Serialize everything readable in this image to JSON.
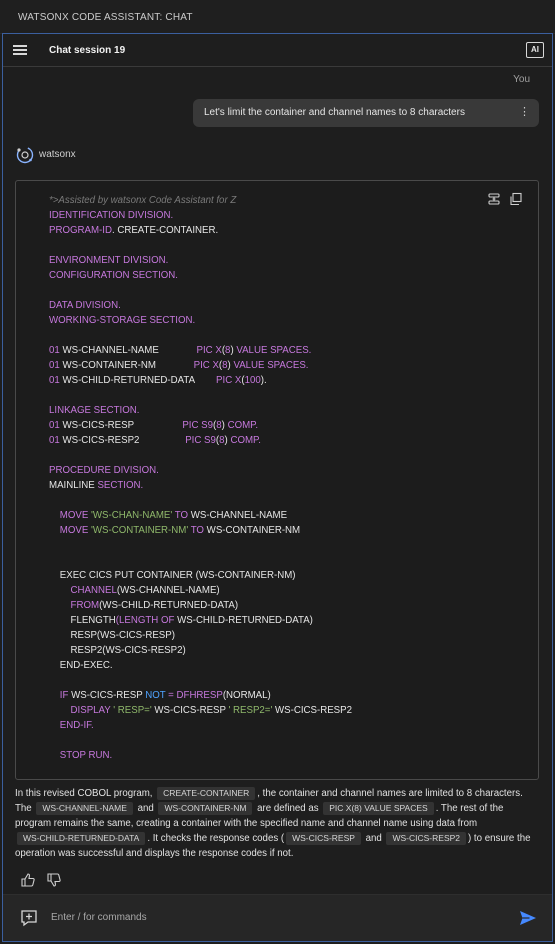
{
  "window": {
    "title": "WATSONX CODE ASSISTANT: CHAT"
  },
  "header": {
    "session_title": "Chat session 19",
    "ai_badge": "AI",
    "menu_icon": "hamburger-menu-icon"
  },
  "user_message": {
    "sender": "You",
    "text": "Let's limit the container and channel names to 8 characters",
    "options_icon": "⋮"
  },
  "assistant": {
    "name": "watsonx",
    "avatar_icon": "watsonx-logo-icon"
  },
  "code_block": {
    "tools": [
      "insert-code-icon",
      "copy-icon"
    ],
    "lines": [
      [
        [
          "c",
          "*>Assisted by watsonx Code Assistant for Z"
        ]
      ],
      [
        [
          "k",
          "IDENTIFICATION DIVISION."
        ]
      ],
      [
        [
          "k",
          "PROGRAM-ID"
        ],
        [
          "t",
          ". CREATE-CONTAINER."
        ]
      ],
      [],
      [
        [
          "k",
          "ENVIRONMENT DIVISION."
        ]
      ],
      [
        [
          "k",
          "CONFIGURATION SECTION."
        ]
      ],
      [],
      [
        [
          "k",
          "DATA DIVISION."
        ]
      ],
      [
        [
          "k",
          "WORKING-STORAGE SECTION."
        ]
      ],
      [],
      [
        [
          "n",
          "01"
        ],
        [
          "t",
          " WS-CHANNEL-NAME              "
        ],
        [
          "k",
          "PIC X"
        ],
        [
          "t",
          "("
        ],
        [
          "n",
          "8"
        ],
        [
          "t",
          ") "
        ],
        [
          "k",
          "VALUE SPACES."
        ]
      ],
      [
        [
          "n",
          "01"
        ],
        [
          "t",
          " WS-CONTAINER-NM              "
        ],
        [
          "k",
          "PIC X"
        ],
        [
          "t",
          "("
        ],
        [
          "n",
          "8"
        ],
        [
          "t",
          ") "
        ],
        [
          "k",
          "VALUE SPACES."
        ]
      ],
      [
        [
          "n",
          "01"
        ],
        [
          "t",
          " WS-CHILD-RETURNED-DATA        "
        ],
        [
          "k",
          "PIC X"
        ],
        [
          "t",
          "("
        ],
        [
          "n",
          "100"
        ],
        [
          "t",
          ")."
        ]
      ],
      [],
      [
        [
          "k",
          "LINKAGE SECTION."
        ]
      ],
      [
        [
          "n",
          "01"
        ],
        [
          "t",
          " WS-CICS-RESP                  "
        ],
        [
          "k",
          "PIC S9"
        ],
        [
          "t",
          "("
        ],
        [
          "n",
          "8"
        ],
        [
          "t",
          ") "
        ],
        [
          "k",
          "COMP."
        ]
      ],
      [
        [
          "n",
          "01"
        ],
        [
          "t",
          " WS-CICS-RESP2                 "
        ],
        [
          "k",
          "PIC S9"
        ],
        [
          "t",
          "("
        ],
        [
          "n",
          "8"
        ],
        [
          "t",
          ") "
        ],
        [
          "k",
          "COMP."
        ]
      ],
      [],
      [
        [
          "k",
          "PROCEDURE DIVISION."
        ]
      ],
      [
        [
          "t",
          "MAINLINE "
        ],
        [
          "k",
          "SECTION."
        ]
      ],
      [],
      [
        [
          "t",
          "    "
        ],
        [
          "k",
          "MOVE "
        ],
        [
          "s",
          "'WS-CHAN-NAME'"
        ],
        [
          "k",
          " TO "
        ],
        [
          "t",
          "WS-CHANNEL-NAME"
        ]
      ],
      [
        [
          "t",
          "    "
        ],
        [
          "k",
          "MOVE "
        ],
        [
          "s",
          "'WS-CONTAINER-NM'"
        ],
        [
          "k",
          " TO "
        ],
        [
          "t",
          "WS-CONTAINER-NM"
        ]
      ],
      [],
      [],
      [
        [
          "t",
          "    EXEC CICS PUT CONTAINER (WS-CONTAINER-NM)"
        ]
      ],
      [
        [
          "t",
          "        "
        ],
        [
          "k",
          "CHANNEL"
        ],
        [
          "t",
          "(WS-CHANNEL-NAME)"
        ]
      ],
      [
        [
          "t",
          "        "
        ],
        [
          "k",
          "FROM"
        ],
        [
          "t",
          "(WS-CHILD-RETURNED-DATA)"
        ]
      ],
      [
        [
          "t",
          "        FLENGTH"
        ],
        [
          "k",
          "(LENGTH OF "
        ],
        [
          "t",
          "WS-CHILD-RETURNED-DATA)"
        ]
      ],
      [
        [
          "t",
          "        RESP(WS-CICS-RESP)"
        ]
      ],
      [
        [
          "t",
          "        RESP2(WS-CICS-RESP2)"
        ]
      ],
      [
        [
          "t",
          "    END-EXEC."
        ]
      ],
      [],
      [
        [
          "t",
          "    "
        ],
        [
          "k",
          "IF "
        ],
        [
          "t",
          "WS-CICS-RESP "
        ],
        [
          "b",
          "NOT"
        ],
        [
          "k",
          " = DFHRESP"
        ],
        [
          "t",
          "(NORMAL)"
        ]
      ],
      [
        [
          "t",
          "        "
        ],
        [
          "k",
          "DISPLAY "
        ],
        [
          "s",
          "' RESP='"
        ],
        [
          "t",
          " WS-CICS-RESP "
        ],
        [
          "s",
          "' RESP2='"
        ],
        [
          "t",
          " WS-CICS-RESP2"
        ]
      ],
      [
        [
          "t",
          "    "
        ],
        [
          "k",
          "END-IF."
        ]
      ],
      [],
      [
        [
          "t",
          "    "
        ],
        [
          "k",
          "STOP RUN."
        ]
      ]
    ]
  },
  "explanation": [
    [
      "t",
      "In this revised COBOL program, "
    ],
    [
      "chip",
      "CREATE-CONTAINER"
    ],
    [
      "t",
      ", the container and channel names are limited to 8 characters. The "
    ],
    [
      "chip",
      "WS-CHANNEL-NAME"
    ],
    [
      "t",
      " and "
    ],
    [
      "chip",
      "WS-CONTAINER-NM"
    ],
    [
      "t",
      " are defined as "
    ],
    [
      "chip",
      "PIC X(8) VALUE SPACES"
    ],
    [
      "t",
      ". The rest of the program remains the same, creating a container with the specified name and channel name using data from "
    ],
    [
      "chip",
      "WS-CHILD-RETURNED-DATA"
    ],
    [
      "t",
      ". It checks the response codes ("
    ],
    [
      "chip",
      "WS-CICS-RESP"
    ],
    [
      "t",
      " and "
    ],
    [
      "chip",
      "WS-CICS-RESP2"
    ],
    [
      "t",
      ") to ensure the operation was successful and displays the response codes if not."
    ]
  ],
  "feedback": {
    "like_icon": "thumbs-up-icon",
    "dislike_icon": "thumbs-down-icon"
  },
  "composer": {
    "placeholder": "Enter / for commands",
    "add_icon": "add-context-icon",
    "send_icon": "send-icon"
  },
  "colors": {
    "keyword": "#c678dd",
    "string": "#8fb86b",
    "operator": "#4fa3ff",
    "send": "#4589ff",
    "frame_border": "#3b5f9e"
  }
}
